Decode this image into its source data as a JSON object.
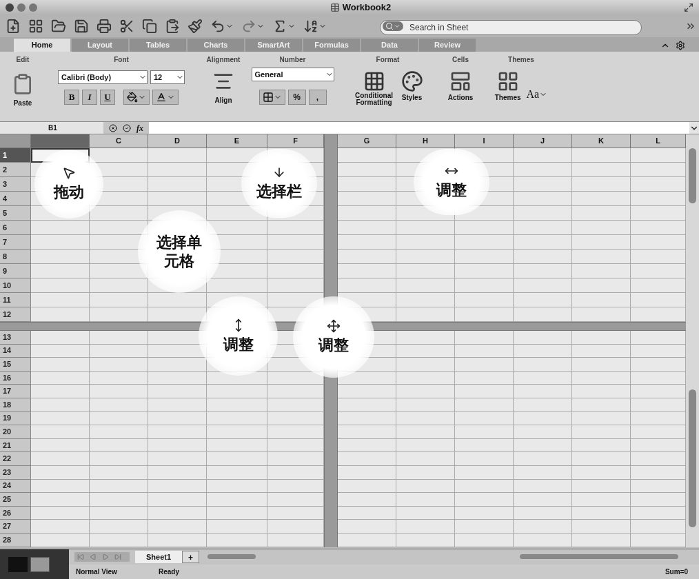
{
  "window": {
    "title": "Workbook2"
  },
  "search": {
    "placeholder": "Search in Sheet"
  },
  "tabs": [
    {
      "label": "Home",
      "selected": true
    },
    {
      "label": "Layout",
      "selected": false
    },
    {
      "label": "Tables",
      "selected": false
    },
    {
      "label": "Charts",
      "selected": false
    },
    {
      "label": "SmartArt",
      "selected": false
    },
    {
      "label": "Formulas",
      "selected": false
    },
    {
      "label": "Data",
      "selected": false
    },
    {
      "label": "Review",
      "selected": false
    }
  ],
  "ribbon": {
    "edit": {
      "title": "Edit",
      "paste": "Paste"
    },
    "font": {
      "title": "Font",
      "family": "Calibri (Body)",
      "size": "12",
      "bold": "B",
      "italic": "I",
      "underline": "U"
    },
    "alignment": {
      "title": "Alignment",
      "align": "Align"
    },
    "number": {
      "title": "Number",
      "format": "General",
      "percent": "%",
      "comma": ","
    },
    "format": {
      "title": "Format",
      "conditional": "Conditional Formatting",
      "styles": "Styles"
    },
    "cells": {
      "title": "Cells",
      "actions": "Actions"
    },
    "themes": {
      "title": "Themes",
      "themes": "Themes",
      "fonts": "Aa"
    }
  },
  "formula_bar": {
    "cell_ref": "B1",
    "fx": "fx"
  },
  "left_columns": [
    {
      "selected": true
    },
    {
      "label": "C",
      "selected": false
    },
    {
      "label": "D",
      "selected": false
    },
    {
      "label": "E",
      "selected": false
    },
    {
      "label": "F",
      "selected": false
    }
  ],
  "right_columns": [
    {
      "label": "G",
      "selected": false
    },
    {
      "label": "H",
      "selected": false
    },
    {
      "label": "I",
      "selected": false
    },
    {
      "label": "J",
      "selected": false
    },
    {
      "label": "K",
      "selected": false
    },
    {
      "label": "L",
      "selected": false
    }
  ],
  "top_rows": [
    {
      "label": "1",
      "selected": true
    },
    {
      "label": "2",
      "selected": false
    },
    {
      "label": "3",
      "selected": false
    },
    {
      "label": "4",
      "selected": false
    },
    {
      "label": "5",
      "selected": false
    },
    {
      "label": "6",
      "selected": false
    },
    {
      "label": "7",
      "selected": false
    },
    {
      "label": "8",
      "selected": false
    },
    {
      "label": "9",
      "selected": false
    },
    {
      "label": "10",
      "selected": false
    },
    {
      "label": "11",
      "selected": false
    },
    {
      "label": "12",
      "selected": false
    }
  ],
  "bottom_rows": [
    {
      "label": "13",
      "selected": false
    },
    {
      "label": "14",
      "selected": false
    },
    {
      "label": "15",
      "selected": false
    },
    {
      "label": "16",
      "selected": false
    },
    {
      "label": "17",
      "selected": false
    },
    {
      "label": "18",
      "selected": false
    },
    {
      "label": "19",
      "selected": false
    },
    {
      "label": "20",
      "selected": false
    },
    {
      "label": "21",
      "selected": false
    },
    {
      "label": "22",
      "selected": false
    },
    {
      "label": "23",
      "selected": false
    },
    {
      "label": "24",
      "selected": false
    },
    {
      "label": "25",
      "selected": false
    },
    {
      "label": "26",
      "selected": false
    },
    {
      "label": "27",
      "selected": false
    },
    {
      "label": "28",
      "selected": false
    }
  ],
  "annotations": [
    {
      "label": "拖动",
      "kind": "pointer"
    },
    {
      "label": "选择栏",
      "kind": "down-arrow"
    },
    {
      "label": "调整",
      "kind": "column-resize"
    },
    {
      "label": "选择单元格",
      "kind": "plain"
    },
    {
      "label": "调整",
      "kind": "row-resize"
    },
    {
      "label": "调整",
      "kind": "move"
    }
  ],
  "sheet_tabs": [
    {
      "label": "Sheet1",
      "selected": true
    }
  ],
  "add_sheet": "+",
  "status_bar": {
    "view": "Normal View",
    "status": "Ready",
    "sum": "Sum=0"
  }
}
